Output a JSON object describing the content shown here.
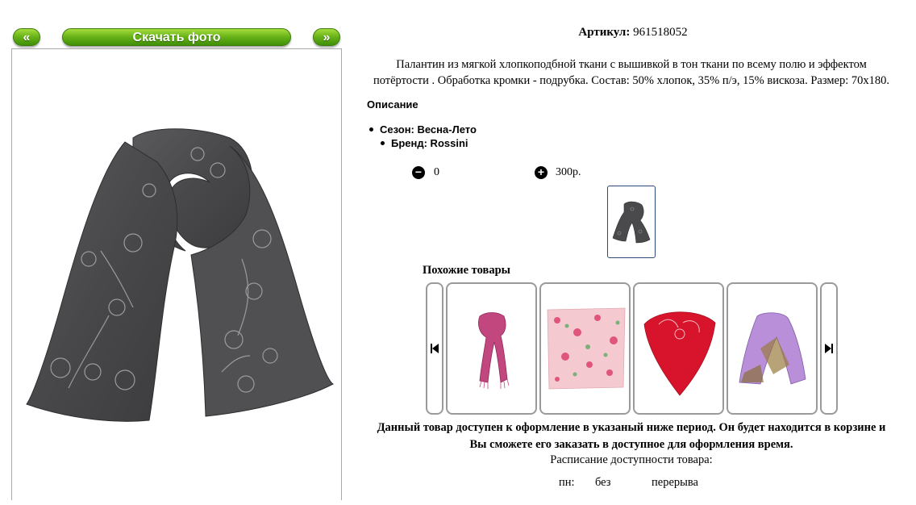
{
  "gallery": {
    "prev_label": "«",
    "download_label": "Скачать фото",
    "next_label": "»"
  },
  "product": {
    "article_label": "Артикул:",
    "article_value": "961518052",
    "description_line1": "Палантин из мягкой хлопкоподбной ткани с вышивкой в тон ткани по всему полю и эффектом",
    "description_line2": "потёртости . Обработка кромки - подрубка. Состав: 50% хлопок, 35% п/э, 15% вискоза. Размер: 70х180.",
    "section_title": "Описание",
    "season": "Сезон: Весна-Лето",
    "brand": "Бренд: Rossini"
  },
  "cart": {
    "minus_icon": "−",
    "plus_icon": "+",
    "quantity": "0",
    "price": "300р."
  },
  "similar": {
    "title": "Похожие товары",
    "items": [
      {
        "name": "pink scarf"
      },
      {
        "name": "floral square shawl"
      },
      {
        "name": "red paisley shawl"
      },
      {
        "name": "purple patterned scarf"
      }
    ]
  },
  "availability": {
    "notice_line1": "Данный товар доступен к оформление в указаный ниже период. Он будет находится в корзине и",
    "notice_line2": "Вы сможете его заказать в доступное для оформления время.",
    "schedule_title": "Расписание доступности товара:",
    "day": "пн:",
    "value1": "без",
    "value2": "перерыва"
  },
  "colors": {
    "button_green": "#6bb51a",
    "thumb_border": "#2b4a7a"
  }
}
